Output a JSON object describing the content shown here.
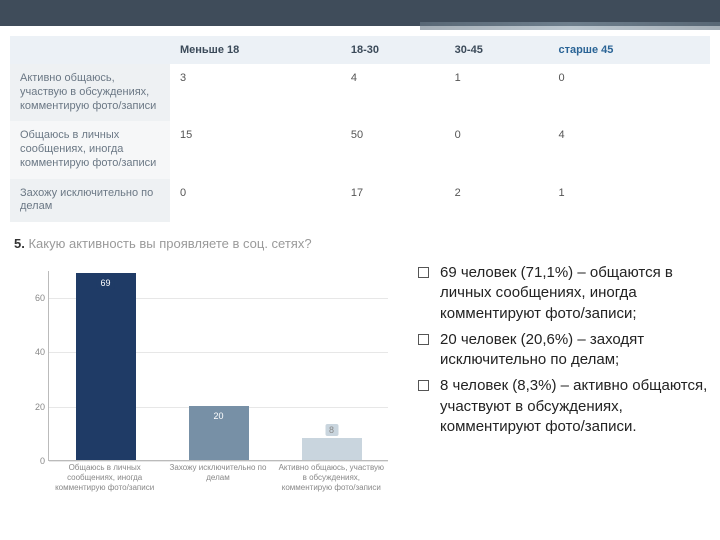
{
  "table": {
    "headers": [
      "",
      "Меньше 18",
      "18-30",
      "30-45",
      "старше 45"
    ],
    "link_col": 4,
    "rows": [
      {
        "label": "Активно общаюсь, участвую в обсуждениях, комментирую фото/записи",
        "cells": [
          "3",
          "4",
          "1",
          "0"
        ]
      },
      {
        "label": "Общаюсь в личных сообщениях, иногда комментирую фото/записи",
        "cells": [
          "15",
          "50",
          "0",
          "4"
        ]
      },
      {
        "label": "Захожу исключительно по делам",
        "cells": [
          "0",
          "17",
          "2",
          "1"
        ]
      }
    ]
  },
  "question": {
    "num": "5.",
    "text": "Какую активность вы проявляете в соц. сетях?"
  },
  "chart_data": {
    "type": "bar",
    "categories": [
      "Общаюсь в личных сообщениях, иногда комментирую фото/записи",
      "Захожу исключительно по делам",
      "Активно общаюсь, участвую в обсуждениях, комментирую фото/записи"
    ],
    "values": [
      69,
      20,
      8
    ],
    "title": "",
    "xlabel": "",
    "ylabel": "",
    "ylim": [
      0,
      70
    ],
    "yticks": [
      0,
      20,
      40,
      60
    ]
  },
  "summary": {
    "items": [
      "69 человек (71,1%) – общаются в личных сообщениях, иногда комментируют фото/записи;",
      "20 человек (20,6%) – заходят исключительно по делам;",
      "8 человек (8,3%) – активно общаются, участвуют в обсуждениях, комментируют фото/записи."
    ]
  }
}
